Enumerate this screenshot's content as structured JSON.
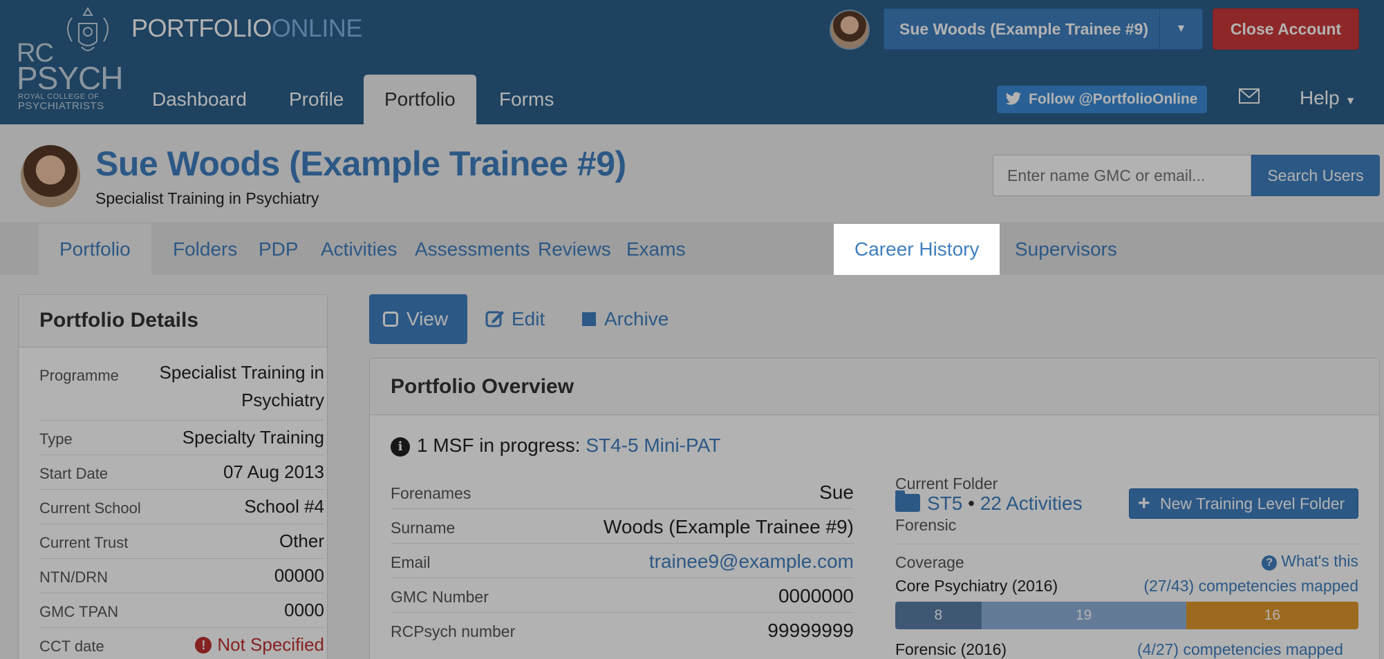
{
  "topbar": {
    "logo": {
      "line1": "RC",
      "line2": "PSYCH",
      "sub1": "ROYAL COLLEGE OF",
      "sub2": "PSYCHIATRISTS"
    },
    "brand_part1": "PORTFOLIO",
    "brand_part2": "ONLINE",
    "user_button": "Sue Woods (Example Trainee #9)",
    "close_account": "Close Account",
    "nav": [
      {
        "label": "Dashboard"
      },
      {
        "label": "Profile"
      },
      {
        "label": "Portfolio"
      },
      {
        "label": "Forms"
      }
    ],
    "active_nav": "Portfolio",
    "twitter": "Follow @PortfolioOnline",
    "help": "Help"
  },
  "header": {
    "title": "Sue Woods (Example Trainee #9)",
    "subtitle": "Specialist Training in Psychiatry",
    "search_placeholder": "Enter name GMC or email...",
    "search_button": "Search Users"
  },
  "subnav": {
    "tabs": [
      {
        "label": "Portfolio"
      },
      {
        "label": "Folders"
      },
      {
        "label": "PDP"
      },
      {
        "label": "Activities"
      },
      {
        "label": "Assessments"
      },
      {
        "label": "Reviews"
      },
      {
        "label": "Exams"
      },
      {
        "label": "Career History"
      },
      {
        "label": "Supervisors"
      }
    ],
    "active": "Portfolio",
    "highlighted": "Career History"
  },
  "details": {
    "title": "Portfolio Details",
    "rows": [
      {
        "label": "Programme",
        "value_line1": "Specialist Training in",
        "value_line2": "Psychiatry"
      },
      {
        "label": "Type",
        "value": "Specialty Training"
      },
      {
        "label": "Start Date",
        "value": "07 Aug 2013"
      },
      {
        "label": "Current School",
        "value": "School #4"
      },
      {
        "label": "Current Trust",
        "value": "Other"
      },
      {
        "label": "NTN/DRN",
        "value": "00000"
      },
      {
        "label": "GMC TPAN",
        "value": "0000"
      },
      {
        "label": "CCT date",
        "value": "Not Specified"
      }
    ]
  },
  "actions": {
    "view": "View",
    "edit": "Edit",
    "archive": "Archive"
  },
  "overview": {
    "title": "Portfolio Overview",
    "msf_text": "1 MSF in progress:",
    "msf_link": "ST4-5 Mini-PAT",
    "rows": [
      {
        "label": "Forenames",
        "value": "Sue"
      },
      {
        "label": "Surname",
        "value": "Woods (Example Trainee #9)"
      },
      {
        "label": "Email",
        "value": "trainee9@example.com"
      },
      {
        "label": "GMC Number",
        "value": "0000000"
      },
      {
        "label": "RCPsych number",
        "value": "99999999"
      }
    ],
    "current_folder_label": "Current Folder",
    "folder_level": "ST5",
    "folder_activities": "22 Activities",
    "folder_specialty": "Forensic",
    "new_folder_button": "New Training Level Folder",
    "coverage_label": "Coverage",
    "whats_this": "What's this",
    "core_name": "Core Psychiatry (2016)",
    "core_mapped": "(27/43) competencies mapped",
    "coverage_bar": [
      {
        "value": 8,
        "color": "#5a7fa6"
      },
      {
        "value": 19,
        "color": "#8fb0d8"
      },
      {
        "value": 16,
        "color": "#e0982c"
      }
    ],
    "forensic_name": "Forensic (2016)",
    "forensic_mapped": "(4/27) competencies mapped"
  }
}
